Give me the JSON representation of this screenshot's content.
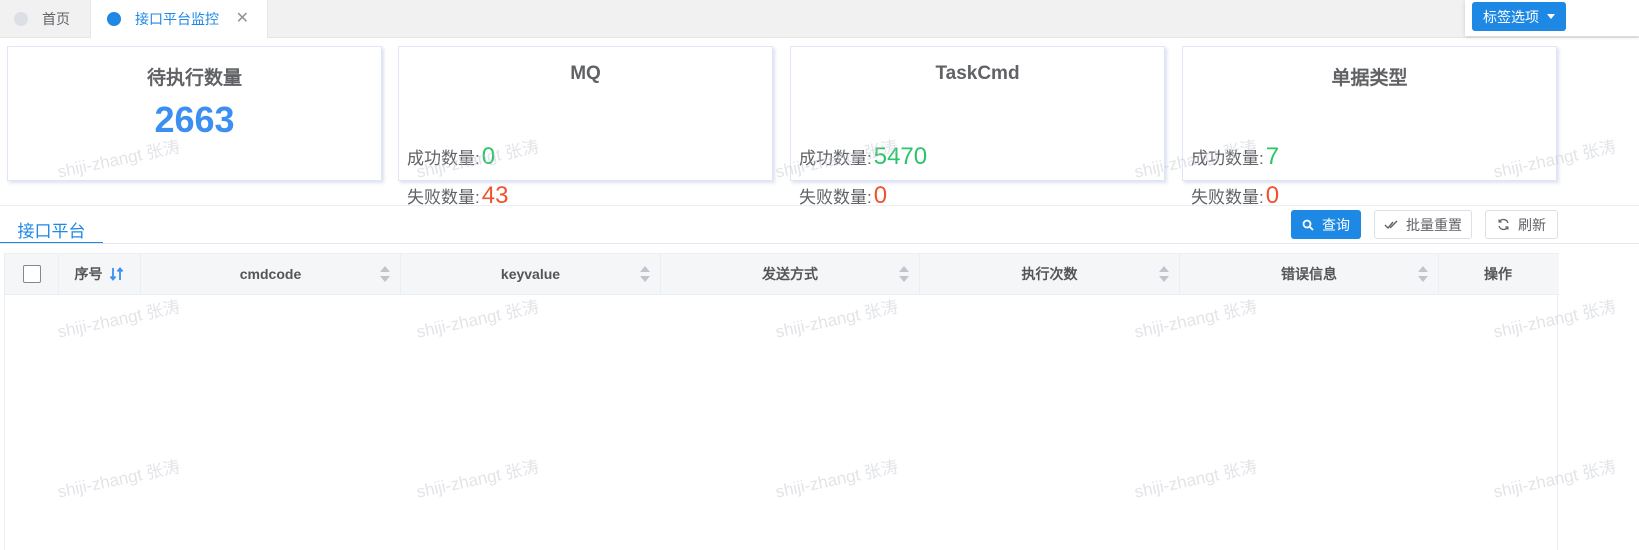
{
  "tabs": {
    "home_label": "首页",
    "active_label": "接口平台监控",
    "close_glyph": "✕",
    "options_label": "标签选项"
  },
  "cards": {
    "pending": {
      "title": "待执行数量",
      "value": "2663"
    },
    "mq": {
      "title": "MQ",
      "success_label": "成功数量:",
      "success_value": "0",
      "fail_label": "失败数量:",
      "fail_value": "43"
    },
    "taskcmd": {
      "title": "TaskCmd",
      "success_label": "成功数量:",
      "success_value": "5470",
      "fail_label": "失败数量:",
      "fail_value": "0"
    },
    "doctype": {
      "title": "单据类型",
      "success_label": "成功数量:",
      "success_value": "7",
      "fail_label": "失败数量:",
      "fail_value": "0"
    }
  },
  "section": {
    "tab_label": "接口平台",
    "query_label": "查询",
    "reset_label": "批量重置",
    "refresh_label": "刷新"
  },
  "table": {
    "columns": [
      "序号",
      "cmdcode",
      "keyvalue",
      "发送方式",
      "执行次数",
      "错误信息",
      "操作"
    ],
    "rows": []
  },
  "watermark": "shiji-zhangt 张涛",
  "colors": {
    "accent": "#1e88e5",
    "success": "#2dc36a",
    "danger": "#f0522e",
    "number": "#3b8ff0"
  },
  "icons": [
    "search-icon",
    "check-double-icon",
    "refresh-icon",
    "sync-icon",
    "close-icon",
    "caret-down-icon"
  ]
}
